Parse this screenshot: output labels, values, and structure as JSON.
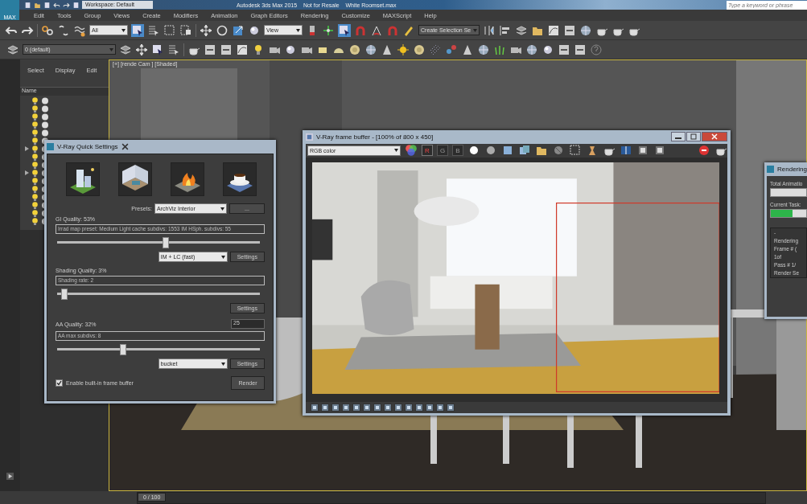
{
  "title_bar": {
    "app_button": "MAX",
    "workspace": "Workspace: Default",
    "title": "Autodesk 3ds Max 2015    Not for Resale    White Roomset.max",
    "search_placeholder": "Type a keyword or phrase"
  },
  "menu": [
    "Edit",
    "Tools",
    "Group",
    "Views",
    "Create",
    "Modifiers",
    "Animation",
    "Graph Editors",
    "Rendering",
    "Customize",
    "MAXScript",
    "Help"
  ],
  "main_toolbar": {
    "selection_filter": "All",
    "reference_coord": "View",
    "named_selection": "Create Selection Se"
  },
  "layer_toolbar": {
    "layer": "0 (default)"
  },
  "command_panel": {
    "tabs": [
      {
        "label": "Select",
        "selected": false
      },
      {
        "label": "Display",
        "selected": false
      },
      {
        "label": "Edit",
        "selected": false
      }
    ],
    "column": "Name",
    "rows": [
      {
        "expandable": false
      },
      {
        "expandable": false
      },
      {
        "expandable": false
      },
      {
        "expandable": false
      },
      {
        "expandable": false
      },
      {
        "expandable": false
      },
      {
        "expandable": true
      },
      {
        "expandable": false
      },
      {
        "expandable": false
      },
      {
        "expandable": true
      },
      {
        "expandable": false
      },
      {
        "expandable": false
      },
      {
        "expandable": false
      },
      {
        "expandable": false
      },
      {
        "expandable": false
      },
      {
        "expandable": false
      }
    ]
  },
  "viewport": {
    "label": "[+] [rende Cam ] [Shaded]"
  },
  "quick_settings": {
    "title": "V-Ray Quick Settings",
    "presets_label": "Presets:",
    "preset": "ArchViz Interior",
    "more_button": "...",
    "sections": [
      {
        "label": "GI Quality: 53%",
        "info": "Irrad map preset: Medium  Light cache subdivs: 1553  IM HSph. subdivs: 55",
        "level": 0.53,
        "dropdown": "IM + LC  (fast)",
        "button": "Settings"
      },
      {
        "label": "Shading Quality: 3%",
        "info": "Shading rate: 2",
        "level": 0.03,
        "button": "Settings"
      },
      {
        "label": "AA Quality: 32%",
        "spinner": "25",
        "info": "AA max subdivs: 8",
        "level": 0.32,
        "dropdown": "bucket",
        "button": "Settings"
      }
    ],
    "frame_buffer_checkbox": {
      "label": "Enable built-in frame buffer",
      "checked": true
    },
    "render_button": "Render"
  },
  "frame_buffer": {
    "title": "V-Ray frame buffer - [100% of 800 x 450]",
    "channel": "RGB color",
    "channels": [
      {
        "label": "R",
        "selected": true
      },
      {
        "label": "G",
        "selected": false
      },
      {
        "label": "B",
        "selected": false
      }
    ]
  },
  "rendering_dialog": {
    "title": "Rendering",
    "total": {
      "label": "Total Animatio",
      "level": 0
    },
    "current_task": {
      "label": "Current Task:",
      "level": 0.62
    },
    "details": [
      "-",
      "Rendering",
      "Frame # (",
      "1of",
      "Pass # 1/",
      "Render Se"
    ]
  },
  "timeline": {
    "position": "0 / 100",
    "level": 0
  }
}
